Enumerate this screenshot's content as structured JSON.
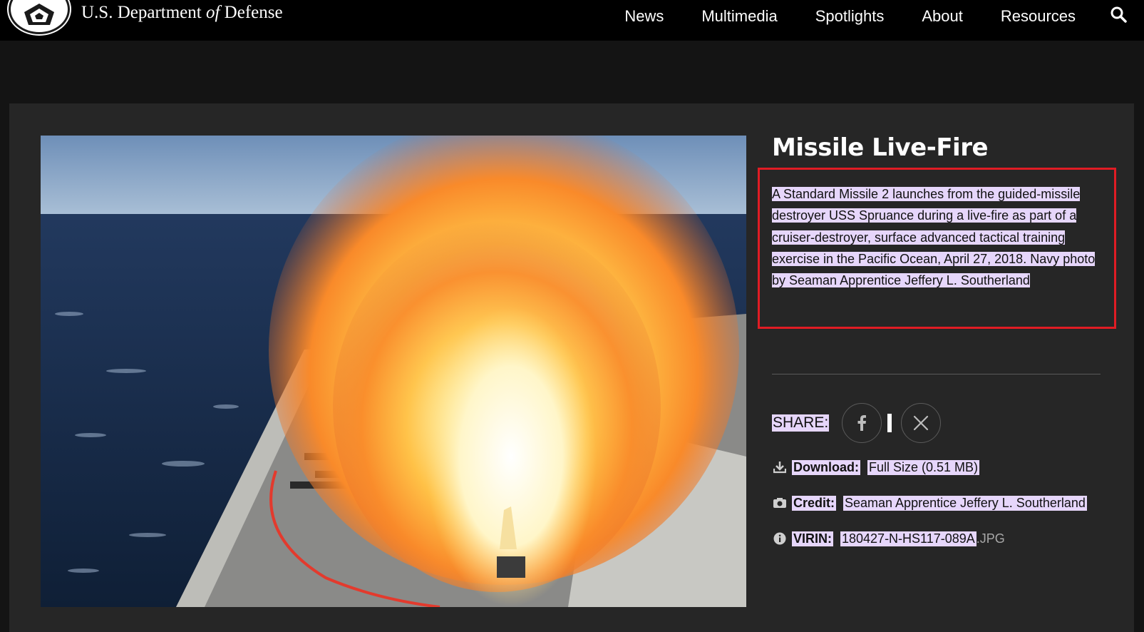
{
  "brand": {
    "pre": "U.S. Department ",
    "italic": "of",
    "post": " Defense"
  },
  "nav": {
    "items": [
      "News",
      "Multimedia",
      "Spotlights",
      "About",
      "Resources"
    ]
  },
  "image": {
    "title": "Missile Live-Fire",
    "description": "A Standard Missile 2 launches from the guided-missile destroyer USS Spruance during a live-fire as part of a cruiser-destroyer, surface advanced tactical training exercise in the Pacific Ocean, April 27, 2018. Navy photo by Seaman Apprentice Jeffery L. Southerland"
  },
  "share": {
    "label": "SHARE:"
  },
  "meta": {
    "download_label": "Download:",
    "download_value": "Full Size (0.51 MB)",
    "credit_label": "Credit:",
    "credit_value": "Seaman Apprentice Jeffery L. Southerland",
    "virin_label": "VIRIN:",
    "virin_value": "180427-N-HS117-089A",
    "virin_suffix": ".JPG"
  },
  "colors": {
    "highlight": "#e6d6fb",
    "annotation_border": "#e01c24",
    "panel": "#262626",
    "topbar": "#000000"
  },
  "icons": [
    "pentagon-seal-logo",
    "search-icon",
    "facebook-icon",
    "x-icon",
    "download-icon",
    "camera-icon",
    "info-icon"
  ]
}
